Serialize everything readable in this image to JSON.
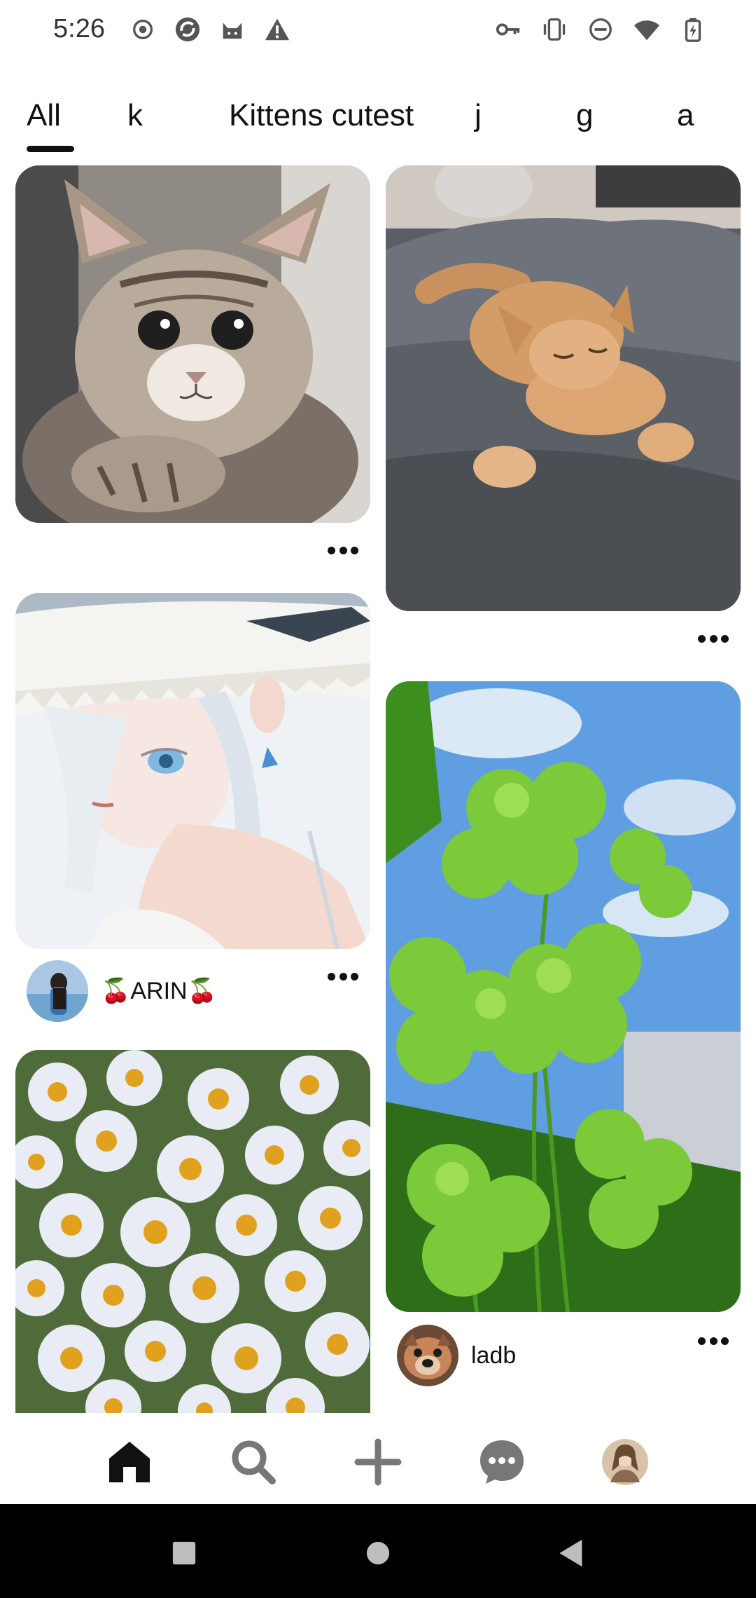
{
  "status_bar": {
    "time": "5:26",
    "left_icons": [
      "record-icon",
      "sync-app-icon",
      "cat-app-icon",
      "warning-icon"
    ],
    "right_icons": [
      "vpn-key-icon",
      "vibrate-icon",
      "do-not-disturb-icon",
      "wifi-icon",
      "battery-charging-icon"
    ]
  },
  "tabs": [
    {
      "label": "All",
      "selected": true
    },
    {
      "label": "k"
    },
    {
      "label": "Kittens cutest"
    },
    {
      "label": "j"
    },
    {
      "label": "g"
    },
    {
      "label": "a"
    }
  ],
  "pins": [
    {
      "image": "kitten-closeup-photo",
      "author": null
    },
    {
      "image": "anime-girl-straw-hat-illustration",
      "author": {
        "name": "🍒ARIN🍒",
        "avatar": "girl-at-beach-avatar"
      }
    },
    {
      "image": "daisies-field-photo",
      "author": null
    },
    {
      "image": "sleeping-orange-cat-photo",
      "author": null
    },
    {
      "image": "four-leaf-clover-photo",
      "author": {
        "name": "ladb",
        "avatar": "dog-face-avatar"
      }
    }
  ],
  "bottom_nav": {
    "items": [
      "home-icon",
      "search-icon",
      "create-icon",
      "messages-icon",
      "profile-avatar"
    ],
    "active": "home-icon"
  },
  "system_nav": [
    "recents-square-icon",
    "home-circle-icon",
    "back-triangle-icon"
  ],
  "colors": {
    "text": "#111111",
    "nav_inactive": "#777777",
    "system_bar": "#000000"
  }
}
